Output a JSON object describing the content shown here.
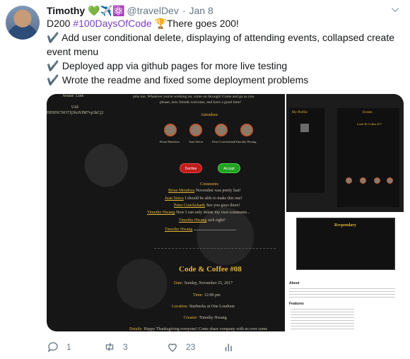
{
  "author": {
    "name": "Timothy",
    "badges": "💚✈️⚛️",
    "handle": "@travelDev",
    "date": "Jan 8"
  },
  "tweet": {
    "line1_prefix": "D200 ",
    "hashtag": "#100DaysOfCode",
    "line1_suffix": " 🏆There goes 200!",
    "check": "✔️",
    "item1": "Add user conditional delete, displaying of attending events, collapsed create event menu",
    "item2": "Deployed app via github pages for more live testing",
    "item3": "Wrote the readme and fixed some deployment problems"
  },
  "media": {
    "main": {
      "avatar_line": "Avatar: Link",
      "uid_label": "Uid:",
      "uid": "HDSNCNO7Jj3fsiXIM7vp3kCj2",
      "intro": "jobs too. Whatever you're working on, come on through! Come and go as you",
      "intro2": "please, new friends welcome, and have a good time!",
      "attendees_heading": "Attendees",
      "attendees": [
        "Brian Mendoza",
        "Juan Sierra",
        "Peter Cruickshank",
        "Timothy Hwang"
      ],
      "decline": "Decline",
      "accept": "Accept",
      "comments_heading": "Comments",
      "comments": [
        {
          "author": "Brian Mendoza",
          "text": "November was pretty fast!"
        },
        {
          "author": "Juan Sierra",
          "text": "I should be able to make this one!"
        },
        {
          "author": "Peter Cruickshank",
          "text": "See you guys there!"
        },
        {
          "author": "Timothy Hwang",
          "text": "Now I can only delete my own comments..."
        },
        {
          "author": "Timothy Hwang",
          "text": "sick right?"
        },
        {
          "author": "Timothy Hwang",
          "text": ""
        }
      ],
      "event_title": "Code & Coffee #08",
      "date_label": "Date:",
      "date": "Sunday, November 25, 2017",
      "time_label": "Time:",
      "time": "12:00 pm",
      "location_label": "Location:",
      "location": "Starbucks at One Loudoun",
      "creator_label": "Creator:",
      "creator": "Timothy Hwang",
      "details_label": "Details:",
      "details": "Happy Thanksgiving everyone! Come share company with us over some"
    },
    "right_top": {
      "profile_heading": "My Profile",
      "events_heading": "Events",
      "event": "Code & Coffee #??"
    },
    "right_bottom": {
      "app_title": "Rsvpendary",
      "about": "About",
      "features": "Features"
    }
  },
  "actions": {
    "replies": "1",
    "retweets": "3",
    "likes": "23"
  },
  "colors": {
    "hashtag": "#7b3fc4",
    "gold": "#e3b63a",
    "secondary": "#657786"
  }
}
